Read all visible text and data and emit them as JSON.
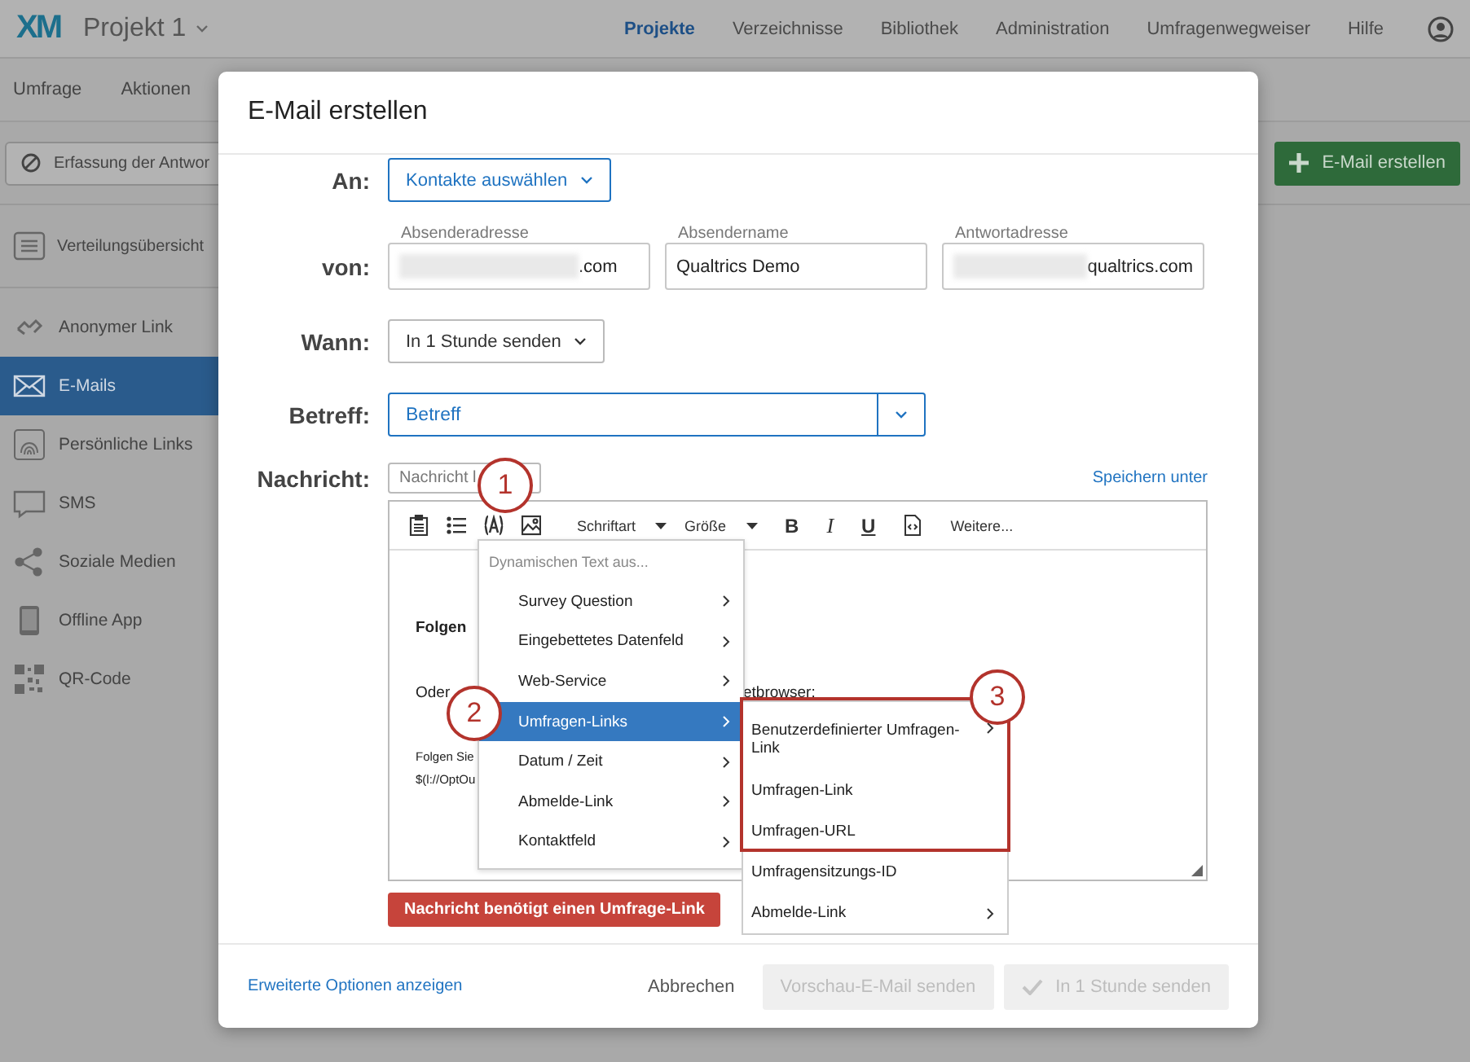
{
  "app": {
    "logo": "XM",
    "project": "Projekt 1",
    "nav": [
      {
        "label": "Projekte",
        "selected": true
      },
      {
        "label": "Verzeichnisse",
        "selected": false
      },
      {
        "label": "Bibliothek",
        "selected": false
      },
      {
        "label": "Administration",
        "selected": false
      },
      {
        "label": "Umfragenwegweiser",
        "selected": false
      },
      {
        "label": "Hilfe",
        "selected": false
      }
    ],
    "subnav": [
      "Umfrage",
      "Aktionen"
    ],
    "collect_button": "Erfassung der Antwor",
    "create_button": "E-Mail erstellen",
    "sidebar": [
      {
        "label": "Verteilungsübersicht",
        "selected": false
      },
      {
        "label": "Anonymer Link",
        "selected": false
      },
      {
        "label": "E-Mails",
        "selected": true
      },
      {
        "label": "Persönliche Links",
        "selected": false
      },
      {
        "label": "SMS",
        "selected": false
      },
      {
        "label": "Soziale Medien",
        "selected": false
      },
      {
        "label": "Offline App",
        "selected": false
      },
      {
        "label": "QR-Code",
        "selected": false
      }
    ]
  },
  "dialog": {
    "title": "E-Mail erstellen",
    "to": {
      "label": "An:",
      "value": "Kontakte auswählen"
    },
    "from": {
      "label": "von:",
      "fields": [
        {
          "caption": "Absenderadresse",
          "value": ".com",
          "redacted": true
        },
        {
          "caption": "Absendername",
          "value": "Qualtrics Demo",
          "redacted": false
        },
        {
          "caption": "Antwortadresse",
          "value": "qualtrics.com",
          "redacted": true
        }
      ]
    },
    "when": {
      "label": "Wann:",
      "value": "In 1 Stunde senden"
    },
    "subject": {
      "label": "Betreff:",
      "value": "Betreff"
    },
    "message": {
      "label": "Nachricht:",
      "template": "Nachricht l",
      "save_link": "Speichern unter",
      "toolbar": [
        {
          "kind": "icon"
        },
        {
          "kind": "icon"
        },
        {
          "kind": "icon"
        },
        {
          "kind": "icon"
        },
        {
          "kind": "dropdown",
          "label": "Schriftart"
        },
        {
          "kind": "dropdown",
          "label": "Größe"
        },
        {
          "kind": "format",
          "label": "B"
        },
        {
          "kind": "format",
          "label": "I"
        },
        {
          "kind": "format",
          "label": "U"
        },
        {
          "kind": "icon"
        },
        {
          "kind": "text",
          "label": "Weitere..."
        }
      ],
      "body": [
        {
          "kind": "bold",
          "parts": [
            "Folgen"
          ]
        },
        {
          "kind": "normal",
          "parts": [
            "Oder",
            "etbrowser:"
          ]
        },
        {
          "kind": "small",
          "parts": [
            "Folgen Sie"
          ]
        },
        {
          "kind": "small",
          "parts": [
            "$(l://OptOu"
          ]
        }
      ]
    },
    "error": "Nachricht benötigt einen Umfrage-Link",
    "menu": {
      "header": "Dynamischen Text aus...",
      "items": [
        {
          "label": "Survey Question",
          "submenu": true,
          "selected": false
        },
        {
          "label": "Eingebettetes Datenfeld",
          "submenu": true,
          "selected": false
        },
        {
          "label": "Web-Service",
          "submenu": true,
          "selected": false
        },
        {
          "label": "Umfragen-Links",
          "submenu": true,
          "selected": true
        },
        {
          "label": "Datum / Zeit",
          "submenu": true,
          "selected": false
        },
        {
          "label": "Abmelde-Link",
          "submenu": true,
          "selected": false
        },
        {
          "label": "Kontaktfeld",
          "submenu": true,
          "selected": false
        }
      ]
    },
    "submenu": {
      "items": [
        {
          "label": "Benutzerdefinierter Umfragen-Link",
          "submenu": true
        },
        {
          "label": "Umfragen-Link",
          "submenu": false
        },
        {
          "label": "Umfragen-URL",
          "submenu": false
        },
        {
          "label": "Umfragensitzungs-ID",
          "submenu": false
        },
        {
          "label": "Abmelde-Link",
          "submenu": true
        }
      ]
    },
    "callouts": [
      "1",
      "2",
      "3"
    ],
    "footer": {
      "link": "Erweiterte Optionen anzeigen",
      "buttons": [
        {
          "label": "Abbrechen",
          "kind": "plain",
          "disabled": false
        },
        {
          "label": "Vorschau-E-Mail senden",
          "kind": "filled",
          "disabled": true
        },
        {
          "label": "In 1 Stunde senden",
          "kind": "check",
          "disabled": true
        }
      ]
    }
  }
}
